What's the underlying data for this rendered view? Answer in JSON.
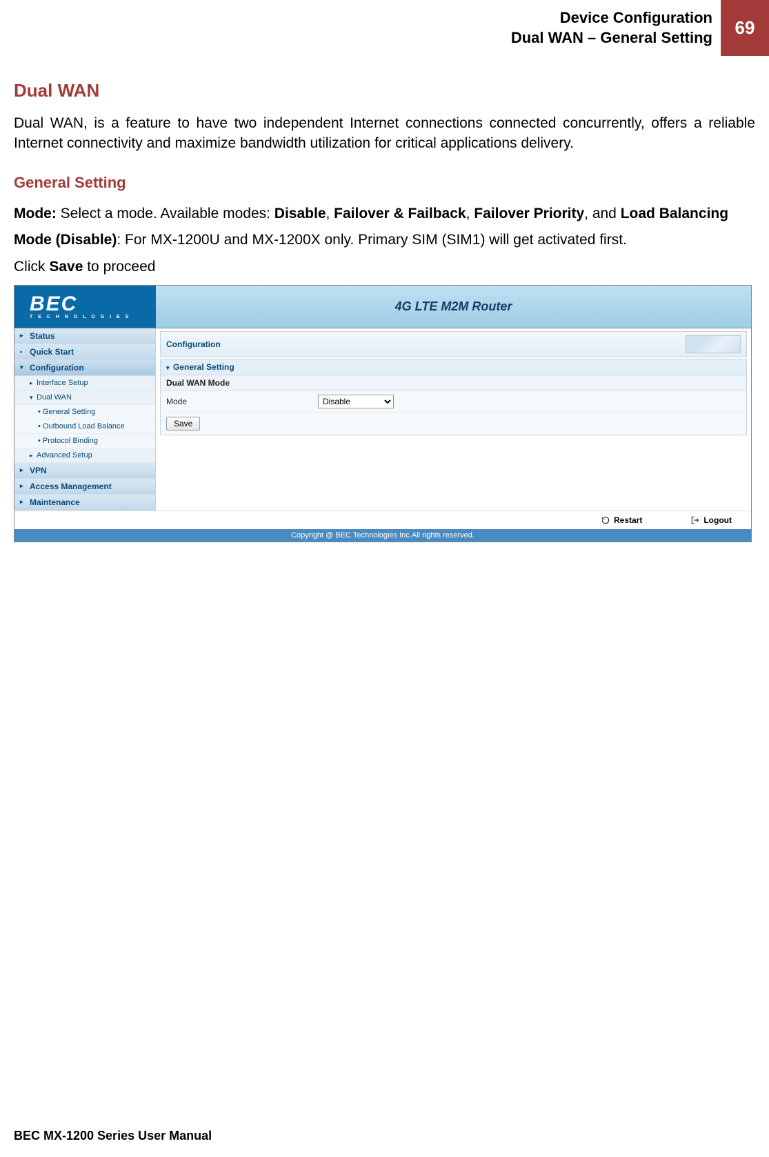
{
  "header": {
    "line1": "Device Configuration",
    "line2": "Dual WAN – General Setting",
    "page_number": "69"
  },
  "section_title": "Dual WAN",
  "intro_paragraph": "Dual WAN, is a feature to have two independent Internet connections connected concurrently, offers a reliable Internet connectivity and maximize bandwidth utilization for critical applications delivery.",
  "subsection_title": "General Setting",
  "mode_line": {
    "label": "Mode:",
    "text1": " Select a mode. Available modes: ",
    "opt1": "Disable",
    "sep1": ", ",
    "opt2": "Failover & Failback",
    "sep2": ", ",
    "opt3": "Failover Priority",
    "sep3": ", and ",
    "opt4": "Load Balancing"
  },
  "mode_disable": {
    "label": "Mode (Disable)",
    "text": ": For MX-1200U and MX-1200X only.  Primary SIM (SIM1) will get activated first."
  },
  "click_save": {
    "pre": "Click ",
    "bold": "Save",
    "post": " to proceed"
  },
  "router": {
    "logo_big": "BEC",
    "logo_small": "T E C H N O L O G I E S",
    "title": "4G LTE M2M Router",
    "sidebar": {
      "status": "Status",
      "quickstart": "Quick Start",
      "configuration": "Configuration",
      "interface_setup": "Interface Setup",
      "dual_wan": "Dual WAN",
      "general_setting": "General Setting",
      "outbound": "Outbound Load Balance",
      "protocol": "Protocol Binding",
      "advanced": "Advanced Setup",
      "vpn": "VPN",
      "access": "Access Management",
      "maintenance": "Maintenance"
    },
    "main": {
      "config_header": "Configuration",
      "panel_title": "General Setting",
      "panel_sub": "Dual WAN Mode",
      "row_label": "Mode",
      "row_value": "Disable",
      "save_btn": "Save"
    },
    "footer": {
      "restart": "Restart",
      "logout": "Logout",
      "copyright": "Copyright @ BEC Technologies Inc.All rights reserved."
    }
  },
  "page_footer": "BEC MX-1200 Series User Manual"
}
